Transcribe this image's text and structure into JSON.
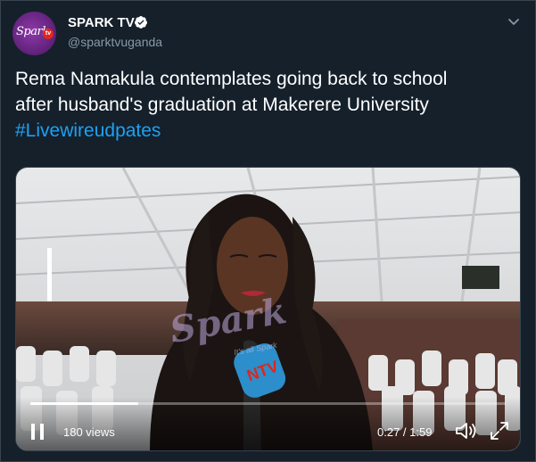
{
  "account": {
    "name": "SPARK TV",
    "handle": "@sparktvuganda",
    "avatar_text": "Spark",
    "avatar_badge": "tv",
    "verified": true
  },
  "tweet": {
    "line1": "Rema Namakula contemplates going back to school",
    "line2": "after husband's graduation at Makerere University",
    "hashtag": "#Livewireudpates"
  },
  "video": {
    "views": "180 views",
    "timecode": "0:27 / 1:59",
    "progress": 0.227,
    "watermark": "Spark",
    "watermark_sub": "It's all Spark",
    "mic_logo": "NTV"
  },
  "icons": {
    "verified": "verified-badge-icon",
    "caret": "chevron-down-icon",
    "pause": "pause-icon",
    "volume": "volume-icon",
    "fullscreen": "fullscreen-icon"
  },
  "colors": {
    "background": "#15202b",
    "secondary_text": "#8899a6",
    "link": "#1da1f2",
    "border": "#38444d"
  }
}
